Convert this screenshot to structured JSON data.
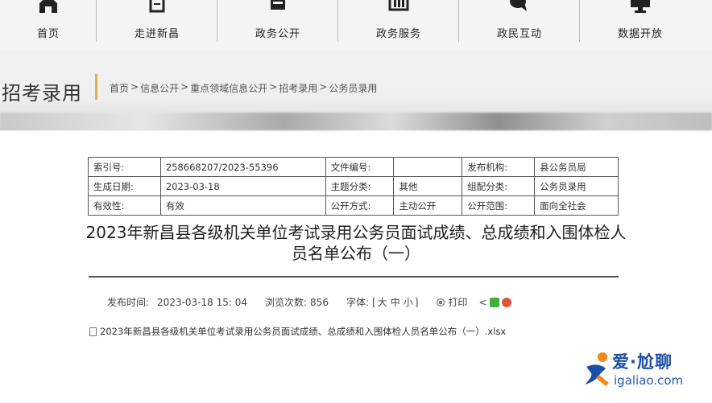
{
  "nav": {
    "items": [
      {
        "label": "首页",
        "icon": "home-icon"
      },
      {
        "label": "走进新昌",
        "icon": "document-icon"
      },
      {
        "label": "政务公开",
        "icon": "archive-icon"
      },
      {
        "label": "政务服务",
        "icon": "building-icon"
      },
      {
        "label": "政民互动",
        "icon": "chat-icon"
      },
      {
        "label": "数据开放",
        "icon": "monitor-icon"
      }
    ]
  },
  "section": {
    "title": "招考录用",
    "breadcrumb": [
      "首页",
      ">",
      "信息公开",
      ">",
      "重点领域信息公开",
      ">",
      "招考录用",
      ">",
      "公务员录用"
    ]
  },
  "info": {
    "index_label": "索引号:",
    "index_value": "258668207/2023-55396",
    "docno_label": "文件编号:",
    "docno_value": "",
    "publisher_label": "发布机构:",
    "publisher_value": "县公务员局",
    "date_label": "生成日期:",
    "date_value": "2023-03-18",
    "topic_label": "主题分类:",
    "topic_value": "其他",
    "org_label": "组配分类:",
    "org_value": "公务员录用",
    "validity_label": "有效性:",
    "validity_value": "有效",
    "method_label": "公开方式:",
    "method_value": "主动公开",
    "scope_label": "公开范围:",
    "scope_value": "面向全社会"
  },
  "article": {
    "title": "2023年新昌县各级机关单位考试录用公务员面试成绩、总成绩和入围体检人员名单公布（一）"
  },
  "meta": {
    "publish_label": "发布时间:",
    "publish_value": "2023-03-18 15: 04",
    "views_label": "浏览次数:",
    "views_value": "856",
    "font_label": "字体:",
    "font_open": "[",
    "font_large": "大",
    "font_medium": "中",
    "font_small": "小",
    "font_close": "]",
    "print_label": "打印",
    "share_prefix": "<"
  },
  "attachment": {
    "name": "2023年新昌县各级机关单位考试录用公务员面试成绩、总成绩和入围体检人员名单公布（一）.xlsx"
  },
  "watermark": {
    "text": "爱·尬聊",
    "url": "igaliao.com"
  },
  "colors": {
    "accent_bar": "#d6b25a",
    "watermark_blue": "#1a4fa6",
    "watermark_orange": "#f08a1c"
  }
}
